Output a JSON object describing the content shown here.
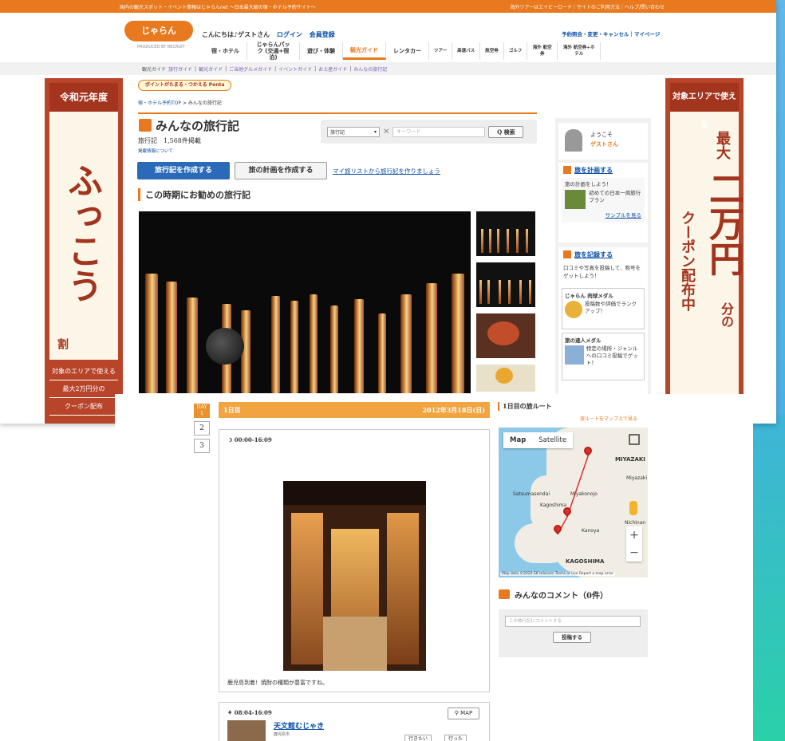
{
  "topbar": {
    "left": "国内の観光スポット・イベント情報はじゃらんnet 〜日本最大級の宿・ホテル予約サイト〜",
    "right": "海外ツアーはエイビーロード｜サイトのご利用方法｜ヘルプ/問い合わせ"
  },
  "header": {
    "logo": "じゃらん",
    "logo_sub": "PRODUCED BY RECRUIT",
    "greeting": "こんにちは♪ゲストさん",
    "login": "ログイン",
    "register": "会員登録",
    "account_links": "予約照会・変更・キャンセル｜マイページ"
  },
  "nav": [
    {
      "label": "宿・ホテル"
    },
    {
      "label": "じゃらんパック (交通+宿泊)"
    },
    {
      "label": "遊び・体験"
    },
    {
      "label": "観光ガイド",
      "active": true
    },
    {
      "label": "レンタカー"
    },
    {
      "label": "ツアー"
    },
    {
      "label": "高速バス"
    },
    {
      "label": "航空券"
    },
    {
      "label": "ゴルフ"
    },
    {
      "label": "海外 航空券"
    },
    {
      "label": "海外 航空券+ホテル"
    }
  ],
  "subnav": {
    "current": "観光ガイド",
    "items": [
      "旅行ガイド",
      "観光ガイド",
      "ご当地グルメガイド",
      "イベントガイド",
      "お土産ガイド",
      "みんなの旅行記"
    ]
  },
  "banner_left": {
    "header": "令和元年度",
    "big": "ふっこう",
    "small": "割",
    "foot1": "対象のエリアで使える",
    "foot2": "最大2万円分の",
    "foot3": "クーポン配布"
  },
  "banner_right": {
    "header": "対象エリアで使える",
    "line1": "最大",
    "line2": "二万円",
    "line3": "分の",
    "line4": "クーポン配布中"
  },
  "ponta": "ポイントがたまる・つかえる Ponta",
  "breadcrumb": {
    "link": "宿・ホテル予約TOP",
    "current": "> みんなの旅行記"
  },
  "page": {
    "title": "みんなの旅行記",
    "count": "旅行記　1,568件掲載",
    "about": "掲載情報について"
  },
  "search": {
    "select": "旅行記",
    "placeholder": "キーワード",
    "button": "Q 検索"
  },
  "buttons": {
    "create_record": "旅行記を作成する",
    "create_plan": "旅の計画を作成する",
    "mylist": "マイ旅リストから旅行記を作りましょう"
  },
  "section": "この時期にお勧めの旅行記",
  "sidebar": {
    "welcome1": "ようこそ",
    "welcome2": "ゲストさん",
    "plan_head": "旅を計画する",
    "plan_text": "旅の計画をしよう！",
    "plan_sample": "初めての日本一周旅行プラン",
    "plan_link": "サンプルを見る",
    "record_head": "旅を記録する",
    "record_text": "口コミや写真を投稿して、称号をゲットしよう！",
    "medal1_title": "じゃらん 肉球メダル",
    "medal1_text": "投稿数や評価でランクアップ！",
    "medal2_title": "旅の達人メダル",
    "medal2_text": "特定の場所・ジャンルへの口コミ投稿でゲット！"
  },
  "detail": {
    "day_tabs": [
      "DAY 1",
      "2",
      "3"
    ],
    "day_label": "1日目",
    "date": "2012年3月18日(日)",
    "entry1_time": "00:00-16:09",
    "entry1_caption": "鹿児島到着！焼酎の種類が豊富ですね。",
    "entry2_time": "08:04-16:09",
    "entry2_name": "天文館むじゃき",
    "entry2_city": "鹿児島市",
    "map_btn": "MAP",
    "btn_want": "行きたい",
    "btn_went": "行った"
  },
  "route": {
    "heading": "1日目の旅ルート",
    "link": "旅ルートをマップ上で見る",
    "map_tab": "Map",
    "satellite_tab": "Satellite",
    "labels": [
      "MIYAZAKI",
      "Miyazaki",
      "Satsumasendai",
      "Miyakonojo",
      "Kagoshima",
      "Kanoya",
      "Nichinan",
      "KAGOSHIMA"
    ],
    "footer": "Map data ©2020 SK telecom Terms of Use Report a map error"
  },
  "comments": {
    "heading": "みんなのコメント（0件）",
    "placeholder": "この旅行記にコメントする",
    "post": "投稿する"
  },
  "colors": {
    "brand_orange": "#e8791e",
    "link_blue": "#0b4fa8",
    "banner_red": "#a3341d"
  }
}
